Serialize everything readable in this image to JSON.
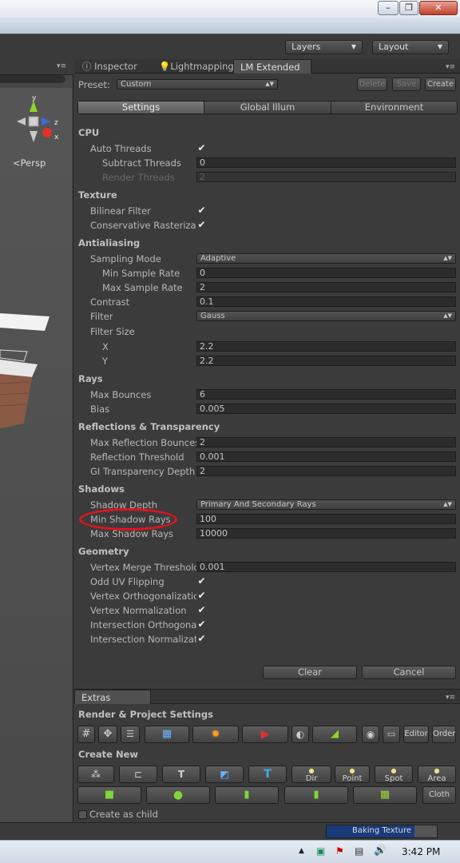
{
  "toolbar": {
    "layers": "Layers",
    "layout": "Layout"
  },
  "scene": {
    "persp": "Persp",
    "axis_y": "y",
    "axis_z": "z",
    "axis_x": "x"
  },
  "tabs": {
    "inspector": "Inspector",
    "lightmapping": "Lightmapping",
    "lm_extended": "LM Extended"
  },
  "preset": {
    "label": "Preset:",
    "value": "Custom",
    "delete": "Delete",
    "save": "Save",
    "create": "Create"
  },
  "subtabs": {
    "settings": "Settings",
    "global_illum": "Global Illum",
    "environment": "Environment"
  },
  "sections": {
    "cpu": "CPU",
    "texture": "Texture",
    "antialiasing": "Antialiasing",
    "rays": "Rays",
    "reflections": "Reflections & Transparency",
    "shadows": "Shadows",
    "geometry": "Geometry"
  },
  "rows": {
    "auto_threads": {
      "label": "Auto Threads",
      "checked": true
    },
    "subtract_threads": {
      "label": "Subtract Threads",
      "value": "0"
    },
    "render_threads": {
      "label": "Render Threads",
      "value": "2"
    },
    "bilinear_filter": {
      "label": "Bilinear Filter",
      "checked": true
    },
    "conservative_raster": {
      "label": "Conservative Rasteriza",
      "checked": true
    },
    "sampling_mode": {
      "label": "Sampling Mode",
      "value": "Adaptive"
    },
    "min_sample_rate": {
      "label": "Min Sample Rate",
      "value": "0"
    },
    "max_sample_rate": {
      "label": "Max Sample Rate",
      "value": "2"
    },
    "contrast": {
      "label": "Contrast",
      "value": "0.1"
    },
    "filter": {
      "label": "Filter",
      "value": "Gauss"
    },
    "filter_size": {
      "label": "Filter Size"
    },
    "filter_x": {
      "label": "X",
      "value": "2.2"
    },
    "filter_y": {
      "label": "Y",
      "value": "2.2"
    },
    "max_bounces": {
      "label": "Max Bounces",
      "value": "6"
    },
    "bias": {
      "label": "Bias",
      "value": "0.005"
    },
    "max_reflection_bounces": {
      "label": "Max Reflection Bounces",
      "value": "2"
    },
    "reflection_threshold": {
      "label": "Reflection Threshold",
      "value": "0.001"
    },
    "gi_transparency_depth": {
      "label": "GI Transparency Depth",
      "value": "2"
    },
    "shadow_depth": {
      "label": "Shadow Depth",
      "value": "Primary And Secondary Rays"
    },
    "min_shadow_rays": {
      "label": "Min Shadow Rays",
      "value": "100"
    },
    "max_shadow_rays": {
      "label": "Max Shadow Rays",
      "value": "10000"
    },
    "vertex_merge_threshold": {
      "label": "Vertex Merge Threshold",
      "value": "0.001"
    },
    "odd_uv_flipping": {
      "label": "Odd UV Flipping",
      "checked": true
    },
    "vertex_orthogonalization": {
      "label": "Vertex Orthogonalization",
      "checked": true
    },
    "vertex_normalization": {
      "label": "Vertex Normalization",
      "checked": true
    },
    "intersection_orthogonalization": {
      "label": "Intersection Orthogonal",
      "checked": true
    },
    "intersection_normalization": {
      "label": "Intersection Normalizat",
      "checked": true
    }
  },
  "actions": {
    "clear": "Clear",
    "cancel": "Cancel"
  },
  "extras": {
    "tab": "Extras",
    "render_settings": "Render & Project Settings",
    "editor": "Editor",
    "order": "Order",
    "create_new": "Create New",
    "dir": "Dir",
    "point": "Point",
    "spot": "Spot",
    "area": "Area",
    "cloth": "Cloth",
    "create_as_child": "Create as child"
  },
  "status": {
    "progress_label": "Baking Texture",
    "progress": 0.8
  },
  "taskbar": {
    "time": "3:42 PM"
  },
  "colors": {
    "highlight_circle": "#e0141e",
    "progress": "#1a3a7a"
  }
}
